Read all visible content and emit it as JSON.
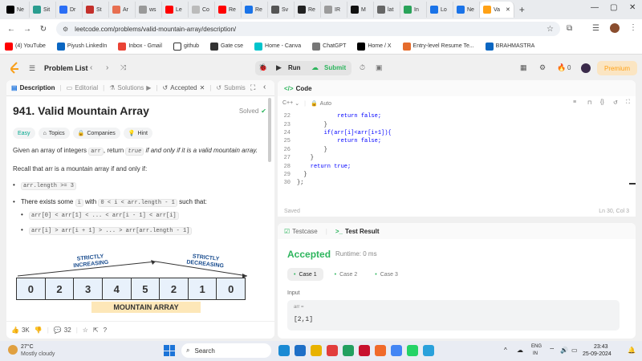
{
  "browser": {
    "tabs": [
      {
        "label": "Ne",
        "color": "#000000"
      },
      {
        "label": "Sit",
        "color": "#2a9d8f"
      },
      {
        "label": "Dr",
        "color": "#2b6ef5"
      },
      {
        "label": "St",
        "color": "#c4302b"
      },
      {
        "label": "Ar",
        "color": "#e76f51"
      },
      {
        "label": "ws",
        "color": "#999999"
      },
      {
        "label": "Le",
        "color": "#ff0000"
      },
      {
        "label": "Co",
        "color": "#bbbbbb"
      },
      {
        "label": "Re",
        "color": "#ff0000"
      },
      {
        "label": "Re",
        "color": "#1a73e8"
      },
      {
        "label": "Sv",
        "color": "#555555"
      },
      {
        "label": "Re",
        "color": "#222222"
      },
      {
        "label": "IR",
        "color": "#9b9b9b"
      },
      {
        "label": "M",
        "color": "#111111"
      },
      {
        "label": "lat",
        "color": "#666666"
      },
      {
        "label": "In",
        "color": "#2aa35a"
      },
      {
        "label": "Lo",
        "color": "#1a73e8"
      },
      {
        "label": "Ne",
        "color": "#1a73e8"
      },
      {
        "label": "Va",
        "color": "#ffa116"
      }
    ],
    "new_tab": "+",
    "url": "leetcode.com/problems/valid-mountain-array/description/",
    "bookmarks": [
      {
        "label": "(4) YouTube",
        "color": "#ff0000"
      },
      {
        "label": "Piyush LinkedIn",
        "color": "#0a66c2"
      },
      {
        "label": "Inbox - Gmail",
        "color": "#ea4335"
      },
      {
        "label": "github",
        "color": "#ffffff"
      },
      {
        "label": "Gate cse",
        "color": "#333333"
      },
      {
        "label": "Home - Canva",
        "color": "#00c4cc"
      },
      {
        "label": "ChatGPT",
        "color": "#777777"
      },
      {
        "label": "Home / X",
        "color": "#000000"
      },
      {
        "label": "Entry-level Resume Te...",
        "color": "#e56c2c"
      },
      {
        "label": "BRAHMASTRA",
        "color": "#0a66c2"
      }
    ]
  },
  "leetcode": {
    "problem_list": "Problem List",
    "run": "Run",
    "submit": "Submit",
    "streak": "0",
    "premium": "Premium"
  },
  "left": {
    "tabs": [
      "Description",
      "Editorial",
      "Solutions",
      "Accepted",
      "Submis"
    ],
    "title": "941. Valid Mountain Array",
    "solved": "Solved",
    "chips": [
      "Easy",
      "Topics",
      "Companies",
      "Hint"
    ],
    "p1a": "Given an array of integers ",
    "p1code": "arr",
    "p1b": ", return ",
    "p1true": "true",
    "p1c": " if and only if it is a valid mountain array.",
    "p2": "Recall that arr is a mountain array if and only if:",
    "b1": "arr.length >= 3",
    "b2a": "There exists some ",
    "b2i": "i",
    "b2b": " with ",
    "b2cond": "0 < i < arr.length - 1",
    "b2c": " such that:",
    "b2s1": "arr[0] < arr[1] < ... < arr[i - 1] < arr[i]",
    "b2s2": "arr[i] > arr[i + 1] > ... > arr[arr.length - 1]",
    "diagram": {
      "values": [
        "0",
        "2",
        "3",
        "4",
        "5",
        "2",
        "1",
        "0"
      ],
      "inc": "STRICTLY INCREASING",
      "dec": "STRICTLY DECREASING",
      "label": "MOUNTAIN ARRAY"
    },
    "likes": "3K",
    "comments": "32"
  },
  "code": {
    "title": "Code",
    "lang": "C++",
    "mode": "Auto",
    "lines": [
      {
        "n": "22",
        "text": "            return false;",
        "indent": 0
      },
      {
        "n": "23",
        "text": "        }",
        "indent": 0
      },
      {
        "n": "24",
        "text": "        if(arr[i]<arr[i+1]){",
        "indent": 0
      },
      {
        "n": "25",
        "text": "            return false;",
        "indent": 0
      },
      {
        "n": "26",
        "text": "        }",
        "indent": 0
      },
      {
        "n": "27",
        "text": "    }",
        "indent": 0
      },
      {
        "n": "28",
        "text": "    return true;",
        "indent": 0
      },
      {
        "n": "29",
        "text": "  }",
        "indent": 0
      },
      {
        "n": "30",
        "text": "};",
        "indent": 0
      }
    ],
    "saved": "Saved",
    "position": "Ln 30, Col 3"
  },
  "test": {
    "tab1": "Testcase",
    "tab2": "Test Result",
    "status": "Accepted",
    "runtime": "Runtime: 0 ms",
    "cases": [
      "Case 1",
      "Case 2",
      "Case 3"
    ],
    "input_label": "Input",
    "var_label": "arr =",
    "var_value": "[2,1]"
  },
  "taskbar": {
    "temp": "27°C",
    "weather": "Mostly cloudy",
    "search": "Search",
    "lang1": "ENG",
    "lang2": "IN",
    "time": "23:43",
    "date": "25-09-2024"
  }
}
